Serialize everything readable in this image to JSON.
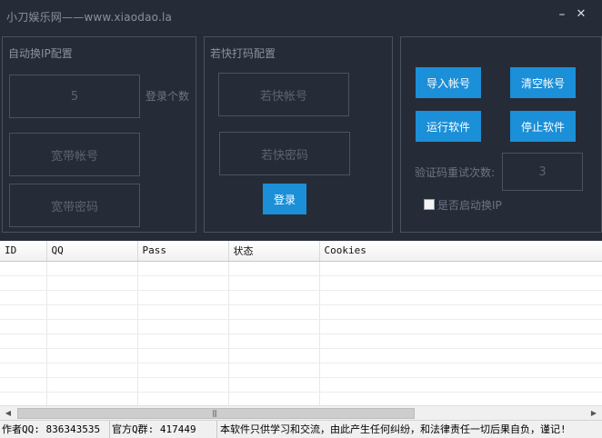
{
  "window": {
    "title": "小刀娱乐网——www.xiaodao.la",
    "minimize_glyph": "–",
    "close_glyph": "✕"
  },
  "ip_config": {
    "title": "自动换IP配置",
    "login_count_value": "5",
    "login_count_label": "登录个数",
    "broadband_account_placeholder": "宽带帐号",
    "broadband_password_placeholder": "宽带密码"
  },
  "ruokuai_config": {
    "title": "若快打码配置",
    "account_placeholder": "若快帐号",
    "password_placeholder": "若快密码",
    "login_button": "登录"
  },
  "actions": {
    "import_accounts": "导入帐号",
    "clear_accounts": "清空帐号",
    "run_software": "运行软件",
    "stop_software": "停止软件",
    "captcha_retry_label": "验证码重试次数:",
    "captcha_retry_value": "3",
    "auto_switch_ip_label": "是否启动换IP",
    "auto_switch_ip_checked": false
  },
  "grid": {
    "columns": [
      "ID",
      "QQ",
      "Pass",
      "状态",
      "Cookies"
    ],
    "empty_rows": 10,
    "grip_glyph": "|||"
  },
  "statusbar": {
    "author": "作者QQ: 836343535",
    "group": "官方Q群: 417449",
    "notice": "本软件只供学习和交流，由此产生任何纠纷，和法律责任一切后果自负，谨记!"
  },
  "colors": {
    "background": "#252c38",
    "border": "#4b5260",
    "button": "#1b8fd8",
    "button_text": "#ffffff"
  }
}
